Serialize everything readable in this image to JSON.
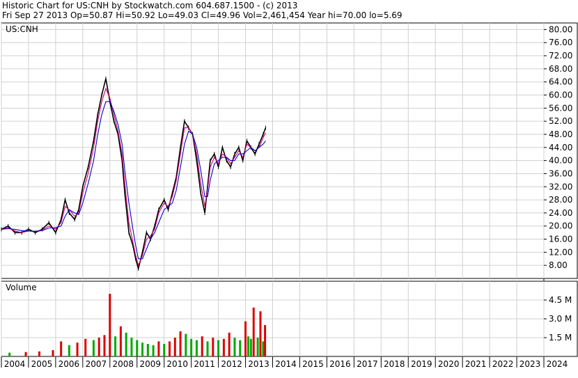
{
  "header": {
    "line1": "Historic Chart for US:CNH by Stockwatch.com 604.687.1500 - (c) 2013",
    "line2": "Fri Sep 27 2013  Op=50.87  Hi=50.92  Lo=49.03  Cl=49.96  Vol=2,461,454  Year hi=70.00  lo=5.69"
  },
  "chart_data": [
    {
      "type": "line",
      "panel": "price",
      "title": "US:CNH",
      "y_ticks": [
        "80.00",
        "76.00",
        "72.00",
        "68.00",
        "64.00",
        "60.00",
        "56.00",
        "52.00",
        "48.00",
        "44.00",
        "40.00",
        "36.00",
        "32.00",
        "28.00",
        "24.00",
        "20.00",
        "16.00",
        "12.00",
        "8.00"
      ],
      "ylim": [
        4,
        82
      ],
      "x_ticks": [
        "2004",
        "2005",
        "2006",
        "2007",
        "2008",
        "2009",
        "2010",
        "2011",
        "2012",
        "2013",
        "2014",
        "2015",
        "2016",
        "2017",
        "2018",
        "2019",
        "2020",
        "2021",
        "2022",
        "2023",
        "2024"
      ],
      "xlim": [
        2004.0,
        2024.0
      ],
      "grid": true,
      "x": [
        2004.0,
        2004.25,
        2004.5,
        2004.75,
        2005.0,
        2005.25,
        2005.5,
        2005.75,
        2006.0,
        2006.2,
        2006.35,
        2006.5,
        2006.7,
        2006.85,
        2007.0,
        2007.2,
        2007.4,
        2007.55,
        2007.7,
        2007.85,
        2008.0,
        2008.15,
        2008.3,
        2008.45,
        2008.55,
        2008.7,
        2008.85,
        2008.95,
        2009.05,
        2009.2,
        2009.35,
        2009.5,
        2009.65,
        2009.8,
        2010.0,
        2010.15,
        2010.3,
        2010.45,
        2010.6,
        2010.75,
        2010.9,
        2011.05,
        2011.2,
        2011.35,
        2011.5,
        2011.6,
        2011.7,
        2011.85,
        2012.0,
        2012.15,
        2012.3,
        2012.45,
        2012.6,
        2012.75,
        2012.9,
        2013.05,
        2013.2,
        2013.35,
        2013.5,
        2013.65,
        2013.74
      ],
      "series": [
        {
          "color": "#000000",
          "values": [
            19,
            20,
            18,
            18,
            19,
            18,
            19,
            21,
            18,
            22,
            28,
            24,
            22,
            25,
            32,
            38,
            46,
            54,
            60,
            65,
            58,
            52,
            48,
            40,
            30,
            18,
            14,
            10,
            7,
            12,
            18,
            16,
            20,
            25,
            28,
            25,
            30,
            35,
            44,
            52,
            50,
            48,
            40,
            30,
            24,
            32,
            40,
            42,
            38,
            44,
            40,
            38,
            42,
            44,
            40,
            46,
            44,
            42,
            45,
            48,
            50
          ]
        },
        {
          "color": "#cc0066",
          "values": [
            19,
            19.5,
            18.5,
            18,
            18.5,
            18.3,
            18.8,
            20,
            19,
            21,
            26,
            25,
            23,
            24,
            30,
            36,
            44,
            52,
            58,
            62,
            59,
            54,
            49,
            42,
            33,
            21,
            15,
            11,
            8,
            11,
            16,
            17,
            19,
            24,
            27,
            26,
            29,
            34,
            42,
            50,
            50,
            48,
            42,
            33,
            26,
            31,
            38,
            41,
            39,
            42,
            41,
            39,
            41,
            43,
            41,
            45,
            44,
            43,
            44,
            47,
            48.5
          ]
        },
        {
          "color": "#0000cc",
          "values": [
            19,
            19.2,
            19,
            18.6,
            18.5,
            18.4,
            18.6,
            19.4,
            19.5,
            20,
            23,
            25,
            24,
            23.5,
            27,
            33,
            40,
            48,
            54,
            58,
            58,
            55,
            51,
            45,
            37,
            27,
            19,
            14,
            10,
            10,
            13,
            16,
            18,
            21,
            25,
            26,
            27,
            31,
            38,
            45,
            49,
            48,
            44,
            37,
            29,
            29,
            34,
            39,
            40,
            41,
            41,
            40,
            40,
            42,
            42,
            43,
            44,
            43,
            44,
            45,
            46
          ]
        }
      ]
    },
    {
      "type": "bar",
      "panel": "volume",
      "title": "Volume",
      "y_ticks": [
        "4.5 M",
        "3.0 M",
        "1.5 M"
      ],
      "ylim": [
        0,
        6.0
      ],
      "x_ticks": [
        "2004",
        "2005",
        "2006",
        "2007",
        "2008",
        "2009",
        "2010",
        "2011",
        "2012",
        "2013",
        "2014",
        "2015",
        "2016",
        "2017",
        "2018",
        "2019",
        "2020",
        "2021",
        "2022",
        "2023",
        "2024"
      ],
      "x": [
        2004.3,
        2004.9,
        2005.4,
        2005.9,
        2006.2,
        2006.5,
        2006.8,
        2007.1,
        2007.4,
        2007.6,
        2007.8,
        2008.0,
        2008.2,
        2008.4,
        2008.6,
        2008.8,
        2009.0,
        2009.2,
        2009.4,
        2009.6,
        2009.8,
        2010.0,
        2010.2,
        2010.4,
        2010.6,
        2010.8,
        2011.0,
        2011.2,
        2011.4,
        2011.6,
        2011.8,
        2012.0,
        2012.2,
        2012.4,
        2012.6,
        2012.8,
        2013.0,
        2013.1,
        2013.2,
        2013.3,
        2013.45,
        2013.55,
        2013.65,
        2013.72
      ],
      "values": [
        0.3,
        0.35,
        0.4,
        0.5,
        1.2,
        0.9,
        1.1,
        1.4,
        1.3,
        1.5,
        1.7,
        5.0,
        1.6,
        2.4,
        1.9,
        1.5,
        1.3,
        1.1,
        1.0,
        0.9,
        1.2,
        1.0,
        1.2,
        1.5,
        2.0,
        1.8,
        1.4,
        1.3,
        1.6,
        1.2,
        1.5,
        1.3,
        1.4,
        1.9,
        1.5,
        1.3,
        2.8,
        1.6,
        1.4,
        3.9,
        1.5,
        3.6,
        1.2,
        2.5
      ],
      "colors_note": "red = down, green = up",
      "up_color": "#00aa00",
      "down_color": "#dd0000"
    }
  ]
}
